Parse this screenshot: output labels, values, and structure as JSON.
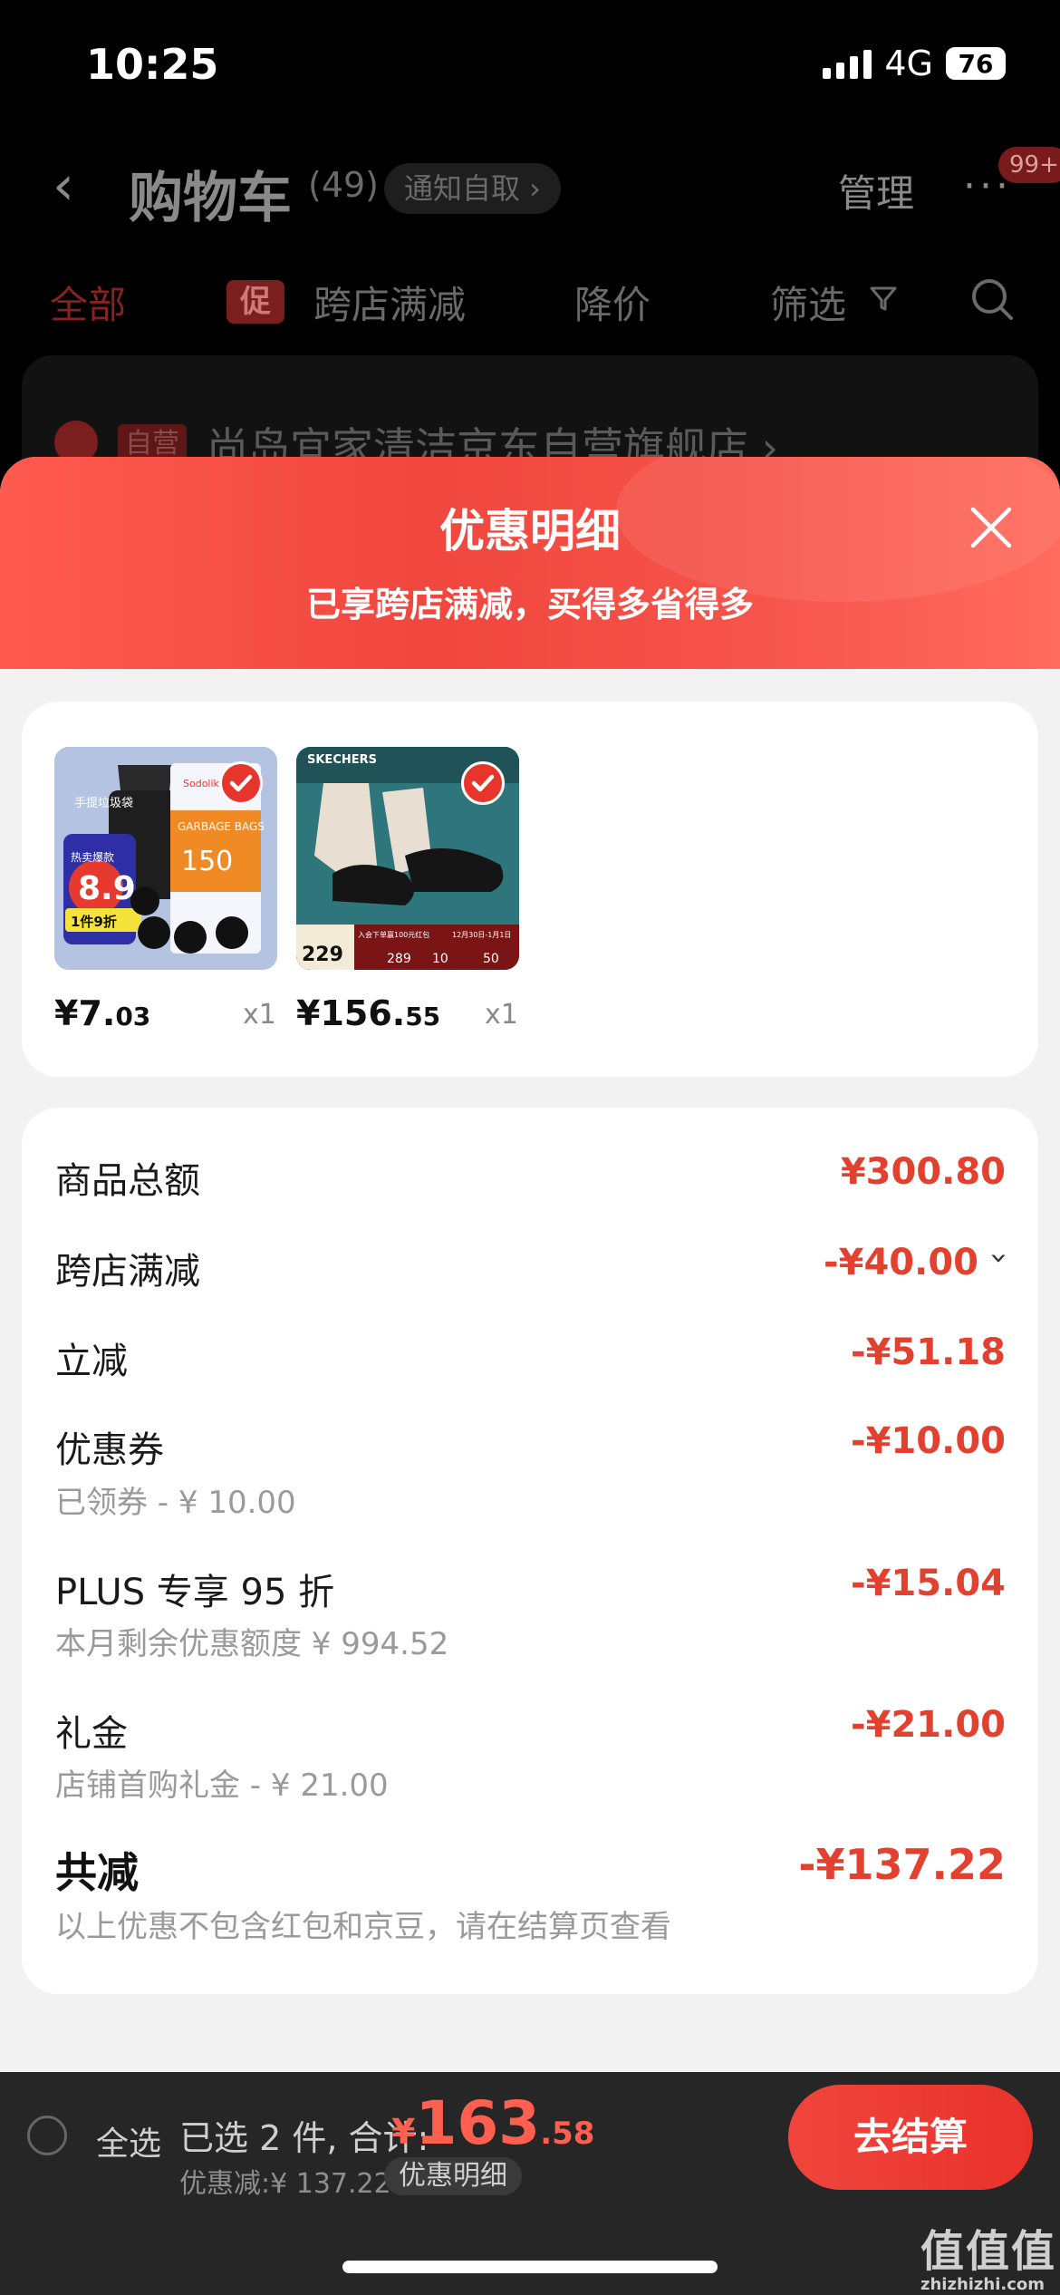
{
  "status": {
    "time": "10:25",
    "network": "4G",
    "battery": "76"
  },
  "background": {
    "title": "购物车",
    "count": "(49)",
    "notice": "通知自取 ›",
    "manage": "管理",
    "more": "···",
    "badge": "99+",
    "tabs": [
      "全部",
      "促",
      "跨店满减",
      "降价",
      "筛选"
    ],
    "store_tag": "自营",
    "store_name": "尚岛宜家清洁京东自营旗舰店 ›"
  },
  "sheet": {
    "title": "优惠明细",
    "subtitle": "已享跨店满减，买得多省得多",
    "products": [
      {
        "price_int": "¥7.",
        "price_dec": "03",
        "qty": "x1",
        "image_texts": {
          "tag1": "手提垃圾袋",
          "tag2": "热卖爆款",
          "price": "8.9",
          "promo": "1件9折",
          "brand": "Sodolike",
          "bag_label": "GARBAGE BAGS",
          "count": "150"
        }
      },
      {
        "price_int": "¥156.",
        "price_dec": "55",
        "qty": "x1",
        "image_texts": {
          "brand": "SKECHERS",
          "price": "229",
          "promo": "入会下单赢100元红包",
          "date": "12月30日-1月1日",
          "p1": "289",
          "p2": "10",
          "p3": "50"
        }
      }
    ],
    "rows": [
      {
        "label": "商品总额",
        "value": "¥300.80"
      },
      {
        "label": "跨店满减",
        "value": "-¥40.00",
        "chevron": "›"
      },
      {
        "label": "立减",
        "value": "-¥51.18"
      },
      {
        "label": "优惠券",
        "value": "-¥10.00",
        "sub": "已领券 - ¥ 10.00"
      },
      {
        "label": "PLUS 专享 95 折",
        "value": "-¥15.04",
        "sub": "本月剩余优惠额度 ¥ 994.52"
      },
      {
        "label": "礼金",
        "value": "-¥21.00",
        "sub": "店铺首购礼金 - ¥ 21.00"
      }
    ],
    "total": {
      "label": "共减",
      "value": "-¥137.22",
      "note": "以上优惠不包含红包和京豆，请在结算页查看"
    }
  },
  "bottom": {
    "select_all": "全选",
    "selected_text": "已选 2 件, 合计:",
    "currency": "¥",
    "amount_int": "163",
    "amount_dec": ".58",
    "discount": "优惠减:¥ 137.22",
    "detail_chip": "优惠明细",
    "checkout": "去结算"
  },
  "watermark": {
    "main": "值值值",
    "sub": "zhizhizhi.com"
  },
  "colors": {
    "accent": "#e2412f",
    "sheet_header": "#f0473e",
    "checkout": "#e9322c"
  }
}
